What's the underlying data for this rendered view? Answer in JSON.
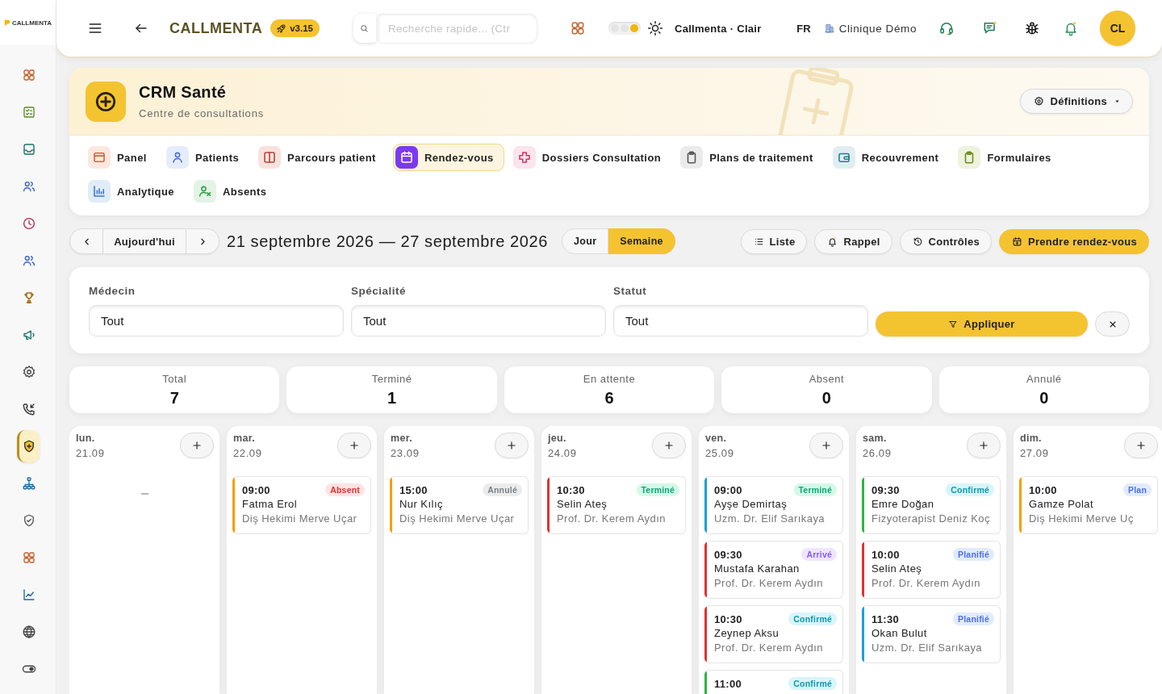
{
  "sidebar": {
    "logo": "CALLMENTA",
    "items": [
      {
        "selected": false
      },
      {
        "selected": false
      },
      {
        "selected": false
      },
      {
        "selected": false
      },
      {
        "selected": false
      },
      {
        "selected": false
      },
      {
        "selected": false
      },
      {
        "selected": false
      },
      {
        "selected": false
      },
      {
        "selected": false
      },
      {
        "selected": true
      },
      {
        "selected": false
      },
      {
        "selected": false
      },
      {
        "selected": false
      },
      {
        "selected": false
      },
      {
        "selected": false
      },
      {
        "selected": false
      }
    ]
  },
  "topbar": {
    "title": "CALLMENTA",
    "version": "v3.15",
    "search": {
      "placeholder": "Recherche rapide... (Ctr"
    },
    "theme_switch": [
      {
        "selected": false
      },
      {
        "selected": false
      },
      {
        "selected": true
      }
    ],
    "theme_label": "Callmenta · Clair",
    "language": "FR",
    "clinic": "Clinique Démo",
    "avatar": "CL"
  },
  "header": {
    "title": "CRM Santé",
    "subtitle": "Centre de consultations",
    "settings_button": "Définitions"
  },
  "tabs": [
    {
      "label": "Panel",
      "selected": false
    },
    {
      "label": "Patients",
      "selected": false
    },
    {
      "label": "Parcours patient",
      "selected": false
    },
    {
      "label": "Rendez-vous",
      "selected": true
    },
    {
      "label": "Dossiers Consultation",
      "selected": false
    },
    {
      "label": "Plans de traitement",
      "selected": false
    },
    {
      "label": "Recouvrement",
      "selected": false
    },
    {
      "label": "Formulaires",
      "selected": false
    },
    {
      "label": "Analytique",
      "selected": false
    },
    {
      "label": "Absents",
      "selected": false
    }
  ],
  "toolbar": {
    "today": "Aujourd'hui",
    "date_range": "21 septembre 2026 — 27 septembre 2026",
    "views": [
      {
        "label": "Jour",
        "selected": false
      },
      {
        "label": "Semaine",
        "selected": true
      }
    ],
    "actions": [
      {
        "label": "Liste",
        "kind": "list"
      },
      {
        "label": "Rappel",
        "kind": "reminder"
      },
      {
        "label": "Contrôles",
        "kind": "controls"
      },
      {
        "label": "Prendre rendez-vous",
        "kind": "create"
      }
    ]
  },
  "filters": {
    "fields": [
      {
        "label": "Médecin",
        "value": "Tout"
      },
      {
        "label": "Spécialité",
        "value": "Tout"
      },
      {
        "label": "Statut",
        "value": "Tout"
      }
    ],
    "apply_button": "Appliquer"
  },
  "stats": [
    {
      "label": "Total",
      "value": "7"
    },
    {
      "label": "Terminé",
      "value": "1"
    },
    {
      "label": "En attente",
      "value": "6"
    },
    {
      "label": "Absent",
      "value": "0"
    },
    {
      "label": "Annulé",
      "value": "0"
    }
  ],
  "days": [
    {
      "day": "lun.",
      "date": "21.09"
    },
    {
      "day": "mar.",
      "date": "22.09",
      "appointments": [
        {
          "time": "09:00",
          "status": "Absent",
          "kind": "absent",
          "patient": "Fatma Erol",
          "doctor": "Diş Hekimi Merve Uçar",
          "color": "#f59f00"
        }
      ]
    },
    {
      "day": "mer.",
      "date": "23.09",
      "appointments": [
        {
          "time": "15:00",
          "status": "Annulé",
          "kind": "cancelled",
          "patient": "Nur Kılıç",
          "doctor": "Diş Hekimi Merve Uçar",
          "color": "#f59f00"
        }
      ]
    },
    {
      "day": "jeu.",
      "date": "24.09",
      "appointments": [
        {
          "time": "10:30",
          "status": "Terminé",
          "kind": "done",
          "patient": "Selin Ateş",
          "doctor": "Prof. Dr. Kerem Aydın",
          "color": "#e03131"
        }
      ]
    },
    {
      "day": "ven.",
      "date": "25.09",
      "appointments": [
        {
          "time": "09:00",
          "status": "Terminé",
          "kind": "done",
          "patient": "Ayşe Demirtaş",
          "doctor": "Uzm. Dr. Elif Sarıkaya",
          "color": "#1c9fd8"
        },
        {
          "time": "09:30",
          "status": "Arrivé",
          "kind": "arrived",
          "patient": "Mustafa Karahan",
          "doctor": "Prof. Dr. Kerem Aydın",
          "color": "#e03131"
        },
        {
          "time": "10:30",
          "status": "Confirmé",
          "kind": "confirmed",
          "patient": "Zeynep Aksu",
          "doctor": "Prof. Dr. Kerem Aydın",
          "color": "#e03131"
        },
        {
          "time": "11:00",
          "status": "Confirmé",
          "kind": "confirmed",
          "color": "#2fb344"
        }
      ]
    },
    {
      "day": "sam.",
      "date": "26.09",
      "appointments": [
        {
          "time": "09:30",
          "status": "Confirmé",
          "kind": "confirmed",
          "patient": "Emre Doğan",
          "doctor": "Fizyoterapist Deniz Koç",
          "color": "#2fb344"
        },
        {
          "time": "10:00",
          "status": "Planifié",
          "kind": "planned",
          "patient": "Selin Ateş",
          "doctor": "Prof. Dr. Kerem Aydın",
          "color": "#e03131"
        },
        {
          "time": "11:30",
          "status": "Planifié",
          "kind": "planned",
          "patient": "Okan Bulut",
          "doctor": "Uzm. Dr. Elif Sarıkaya",
          "color": "#1c9fd8"
        }
      ]
    },
    {
      "day": "dim.",
      "date": "27.09",
      "appointments": [
        {
          "time": "10:00",
          "status": "Plan",
          "kind": "planned",
          "patient": "Gamze Polat",
          "doctor": "Diş Hekimi Merve Uç",
          "color": "#f59f00"
        }
      ]
    }
  ]
}
